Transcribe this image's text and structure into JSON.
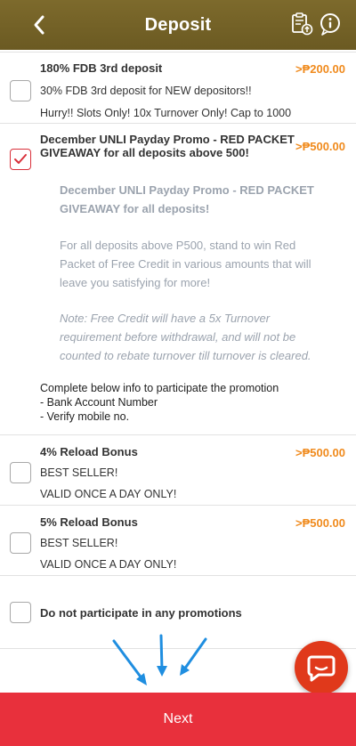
{
  "header": {
    "title": "Deposit",
    "icons": [
      "back-arrow-icon",
      "history-icon",
      "info-icon"
    ]
  },
  "promotions": [
    {
      "title": "180% FDB 3rd deposit",
      "amount": "₱200.00",
      "amount_prefix": ">",
      "checked": false,
      "lines": [
        "30% FDB 3rd deposit for NEW depositors!!",
        "Hurry!! Slots Only! 10x Turnover Only! Cap to 1000"
      ]
    },
    {
      "title_line1": "December UNLI Payday Promo - RED PACKET",
      "title_line2": "GIVEAWAY for all deposits above 500!",
      "amount": "₱500.00",
      "amount_prefix": ">",
      "checked": true,
      "detail_heading_1": "December UNLI Payday Promo - RED PACKET",
      "detail_heading_2": "GIVEAWAY for all deposits!",
      "detail_body_1": "For all deposits above P500, stand to win Red",
      "detail_body_2": "Packet of Free Credit in various amounts that will",
      "detail_body_3": "leave you satisfying for more!",
      "detail_note_1": "Note: Free Credit will have a 5x Turnover",
      "detail_note_2": "requirement before withdrawal, and will not be",
      "detail_note_3": "counted to rebate turnover till turnover is cleared.",
      "requirements": [
        "Complete below info to participate the promotion",
        "- Bank Account Number",
        "- Verify mobile no."
      ]
    },
    {
      "title": "4% Reload Bonus",
      "amount": "₱500.00",
      "amount_prefix": ">",
      "checked": false,
      "lines": [
        "BEST SELLER!",
        "VALID ONCE A DAY ONLY!"
      ]
    },
    {
      "title": "5% Reload Bonus",
      "amount": "₱500.00",
      "amount_prefix": ">",
      "checked": false,
      "lines": [
        "BEST SELLER!",
        "VALID ONCE A DAY ONLY!"
      ]
    }
  ],
  "no_promo": {
    "label": "Do not participate in any promotions",
    "checked": false
  },
  "next_button": "Next",
  "colors": {
    "header": "#7d6a2c",
    "amount": "#f08a1c",
    "checked": "#d9303a",
    "next_button": "#e8303c",
    "chat_fab": "#e0391b",
    "annotation_arrows": "#1f8ee0"
  },
  "chat_icon": "chat-bubble-icon"
}
